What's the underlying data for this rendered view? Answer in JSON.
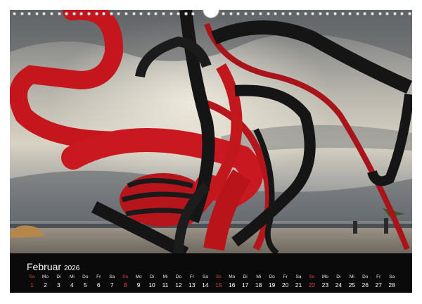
{
  "calendar": {
    "month": "Februar",
    "year": "2026",
    "days": [
      {
        "wd": "So",
        "d": "1",
        "sun": true
      },
      {
        "wd": "Mo",
        "d": "2"
      },
      {
        "wd": "Di",
        "d": "3"
      },
      {
        "wd": "Mi",
        "d": "4"
      },
      {
        "wd": "Do",
        "d": "5"
      },
      {
        "wd": "Fr",
        "d": "6"
      },
      {
        "wd": "Sa",
        "d": "7"
      },
      {
        "wd": "So",
        "d": "8",
        "sun": true
      },
      {
        "wd": "Mo",
        "d": "9"
      },
      {
        "wd": "Di",
        "d": "10"
      },
      {
        "wd": "Mi",
        "d": "11"
      },
      {
        "wd": "Do",
        "d": "12"
      },
      {
        "wd": "Fr",
        "d": "13"
      },
      {
        "wd": "Sa",
        "d": "14"
      },
      {
        "wd": "So",
        "d": "15",
        "sun": true
      },
      {
        "wd": "Mo",
        "d": "16"
      },
      {
        "wd": "Di",
        "d": "17"
      },
      {
        "wd": "Mi",
        "d": "18"
      },
      {
        "wd": "Do",
        "d": "19"
      },
      {
        "wd": "Fr",
        "d": "20"
      },
      {
        "wd": "Sa",
        "d": "21"
      },
      {
        "wd": "So",
        "d": "22",
        "sun": true
      },
      {
        "wd": "Mo",
        "d": "23"
      },
      {
        "wd": "Di",
        "d": "24"
      },
      {
        "wd": "Mi",
        "d": "25"
      },
      {
        "wd": "Do",
        "d": "26"
      },
      {
        "wd": "Fr",
        "d": "27"
      },
      {
        "wd": "Sa",
        "d": "28"
      }
    ]
  },
  "colors": {
    "sunday": "#e0454a",
    "strip": "#0a0a0a",
    "ribbon_red": "#c4161c",
    "ribbon_dark": "#151515"
  }
}
